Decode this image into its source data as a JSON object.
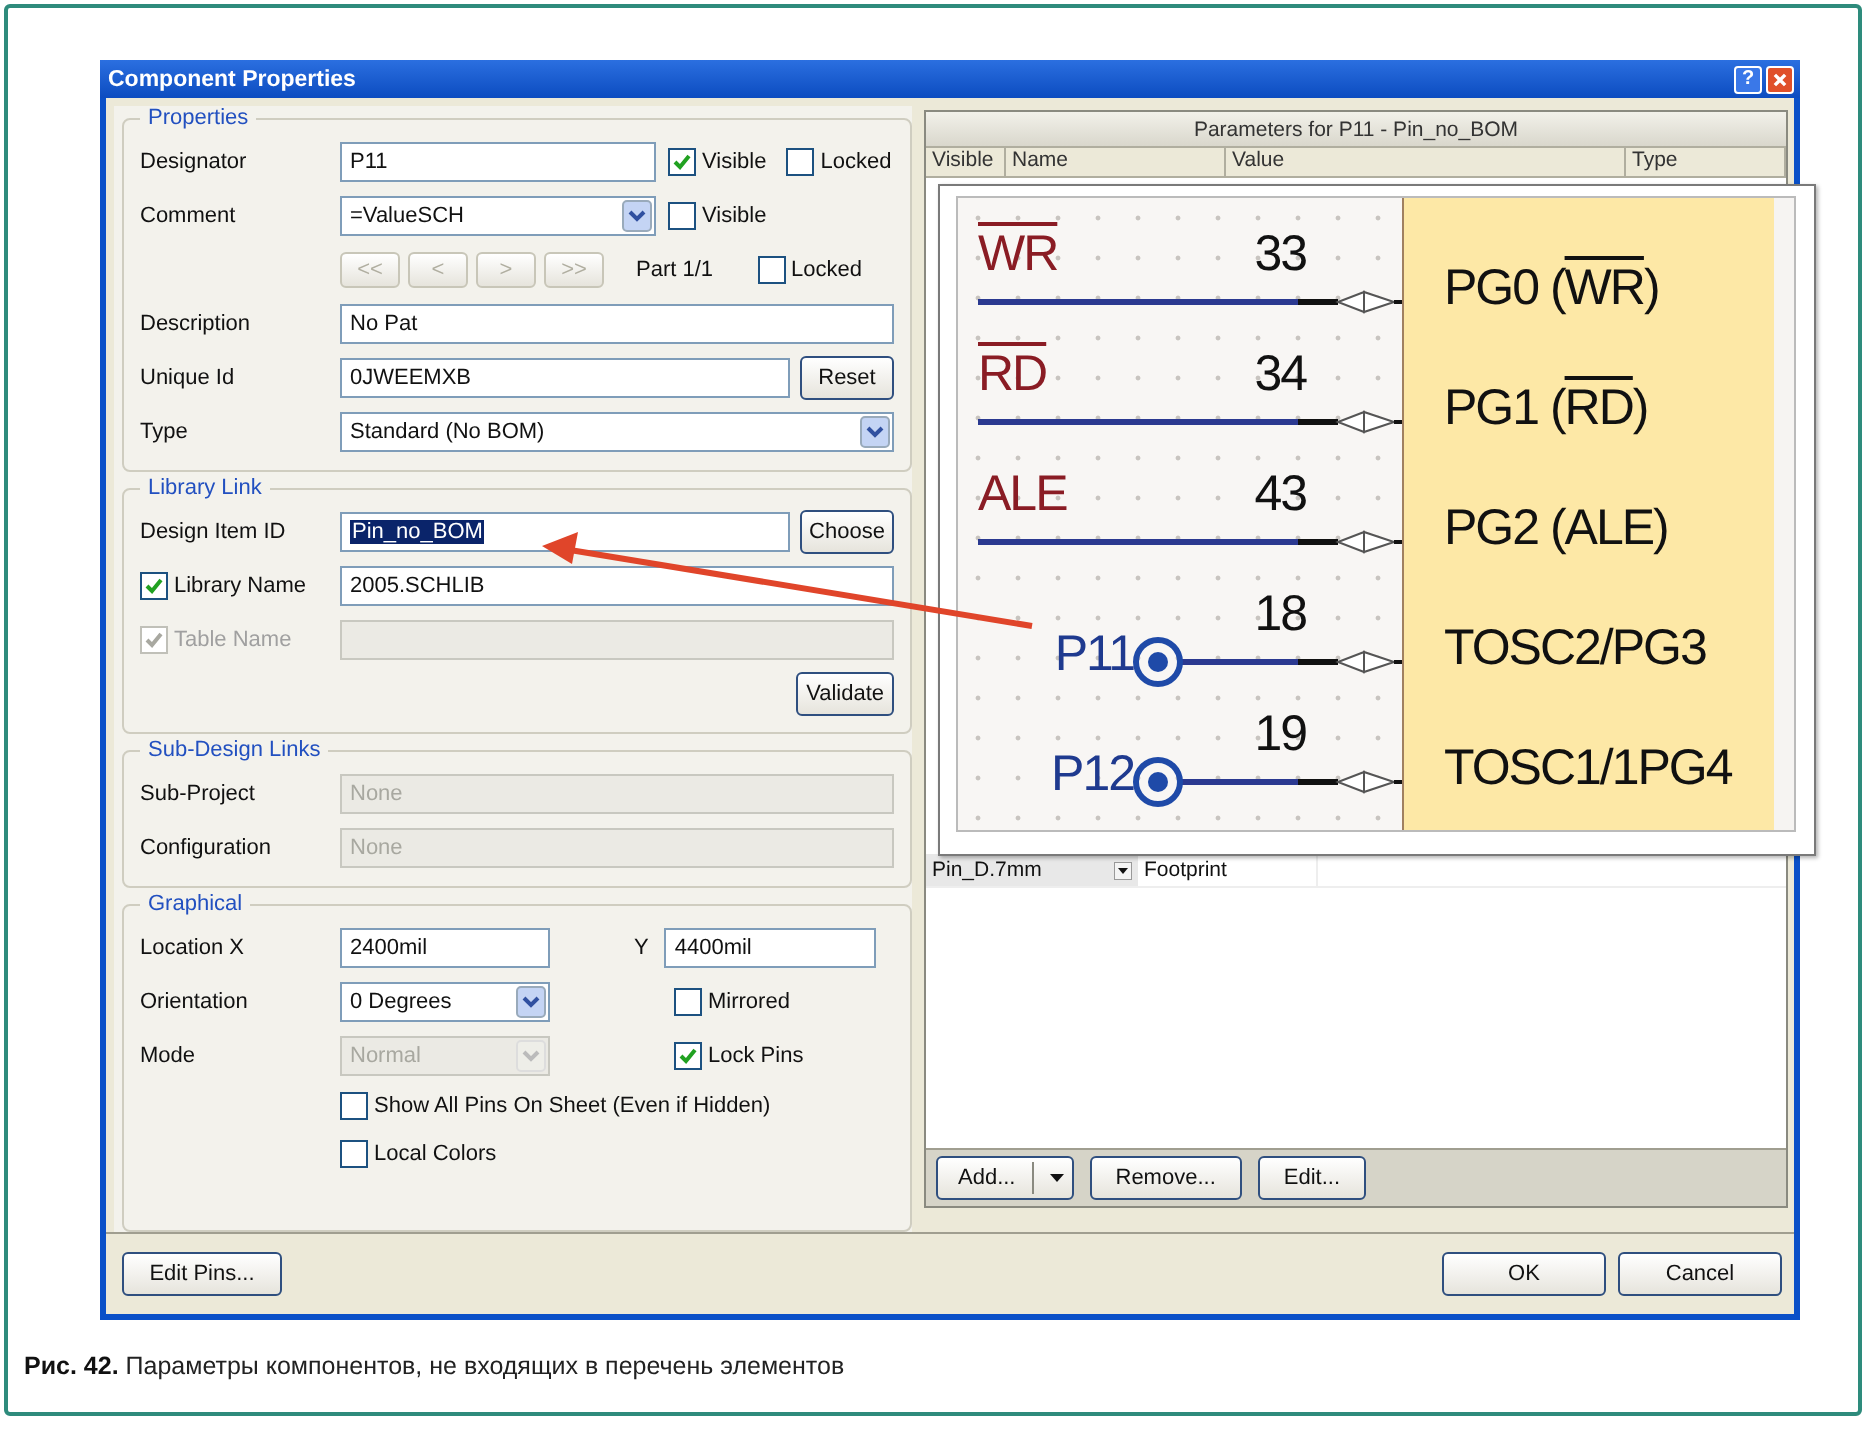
{
  "window": {
    "title": "Component Properties",
    "help_button": "?"
  },
  "properties": {
    "title": "Properties",
    "designator": {
      "label": "Designator",
      "value": "P11",
      "visible": {
        "label": "Visible",
        "checked": true
      },
      "locked": {
        "label": "Locked",
        "checked": false
      }
    },
    "comment": {
      "label": "Comment",
      "value": "=ValueSCH",
      "visible": {
        "label": "Visible",
        "checked": false
      }
    },
    "part_nav": {
      "buttons": [
        "<<",
        "<",
        ">",
        ">>"
      ],
      "disabled": true,
      "part": "Part 1/1",
      "locked": {
        "label": "Locked",
        "checked": false
      }
    },
    "description": {
      "label": "Description",
      "value": "No Pat"
    },
    "unique_id": {
      "label": "Unique Id",
      "value": "0JWEEMXB",
      "button": "Reset"
    },
    "type": {
      "label": "Type",
      "value": "Standard (No BOM)"
    }
  },
  "library_link": {
    "title": "Library Link",
    "design_item_id": {
      "label": "Design Item ID",
      "value": "Pin_no_BOM",
      "selected": true,
      "button": "Choose"
    },
    "library_name": {
      "label": "Library Name",
      "checked": true,
      "value": "2005.SCHLIB"
    },
    "table_name": {
      "label": "Table Name",
      "checked": true,
      "disabled": true
    },
    "validate_button": "Validate"
  },
  "sub_design_links": {
    "title": "Sub-Design Links",
    "rows": [
      {
        "label": "Sub-Project",
        "value": "None",
        "disabled": true
      },
      {
        "label": "Configuration",
        "value": "None",
        "disabled": true
      }
    ]
  },
  "graphical": {
    "title": "Graphical",
    "location_x": {
      "label": "Location X",
      "value": "2400mil"
    },
    "location_y": {
      "label": "Y",
      "value": "4400mil"
    },
    "orientation": {
      "label": "Orientation",
      "value": "0 Degrees"
    },
    "mirrored": {
      "label": "Mirrored",
      "checked": false
    },
    "mode": {
      "label": "Mode",
      "value": "Normal",
      "disabled": true
    },
    "lock_pins": {
      "label": "Lock Pins",
      "checked": true
    },
    "options": [
      {
        "label": "Show All Pins On Sheet (Even if Hidden)",
        "checked": false
      },
      {
        "label": "Local Colors",
        "checked": false
      }
    ]
  },
  "parameters": {
    "title": "Parameters for P11 - Pin_no_BOM",
    "columns": [
      "Visible",
      "Name",
      "Value",
      "Type"
    ],
    "rows": [
      {
        "cells": [
          "Pin_D.7mm",
          "Footprint"
        ]
      }
    ],
    "buttons": [
      {
        "label": "Add...",
        "kind": "split"
      },
      {
        "label": "Remove...",
        "kind": "plain"
      },
      {
        "label": "Edit...",
        "kind": "plain"
      }
    ]
  },
  "schematic": {
    "pins": [
      {
        "kind": "bus",
        "name": "WR",
        "overline": true,
        "number": "33",
        "signal": [
          {
            "text": "PG0 ("
          },
          {
            "text": "WR",
            "overline": true
          },
          {
            "text": ")"
          }
        ]
      },
      {
        "kind": "bus",
        "name": "RD",
        "overline": true,
        "number": "34",
        "signal": [
          {
            "text": "PG1 ("
          },
          {
            "text": "RD",
            "overline": true
          },
          {
            "text": ")"
          }
        ]
      },
      {
        "kind": "bus",
        "name": "ALE",
        "overline": false,
        "number": "43",
        "signal": [
          {
            "text": "PG2 (ALE)"
          }
        ]
      },
      {
        "kind": "port",
        "name": "P11",
        "overline": false,
        "number": "18",
        "signal": [
          {
            "text": "TOSC2/PG3"
          }
        ]
      },
      {
        "kind": "port",
        "name": "P12",
        "overline": false,
        "number": "19",
        "signal": [
          {
            "text": "TOSC1/1PG4"
          }
        ]
      }
    ]
  },
  "footer": {
    "left_button": "Edit Pins...",
    "buttons": [
      "OK",
      "Cancel"
    ]
  },
  "caption": "**Рис. 42.** Параметры компонентов, не входящих в перечень элементов"
}
